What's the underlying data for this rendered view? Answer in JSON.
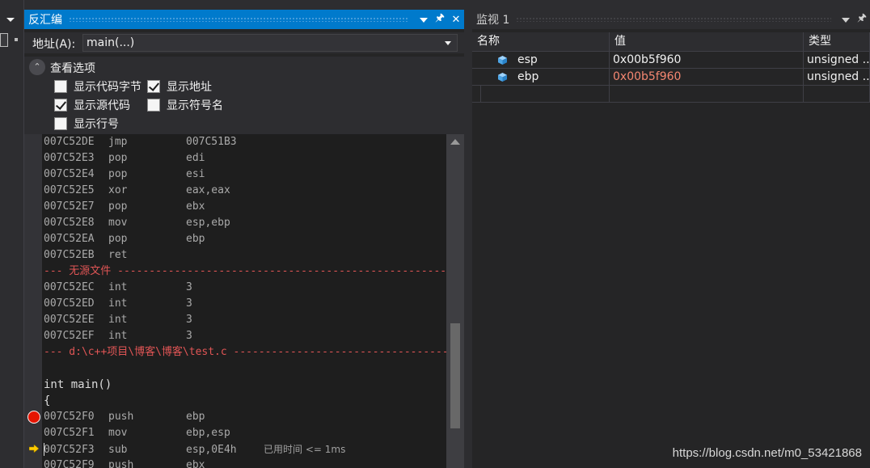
{
  "colors": {
    "accent": "#007acc",
    "separator_red": "#e05555",
    "changed_value": "#f48771",
    "breakpoint": "#e51400",
    "ip_arrow": "#ffcc00"
  },
  "disasm": {
    "title": "反汇编",
    "address_label": "地址(A):",
    "address_value": "main(...)",
    "options_title": "查看选项",
    "options": {
      "show_code_bytes": "显示代码字节",
      "show_address": "显示地址",
      "show_source": "显示源代码",
      "show_symbols": "显示符号名",
      "show_line_numbers": "显示行号"
    },
    "lines": [
      {
        "addr": "007C52DE",
        "mnemonic": "jmp",
        "operand": "007C51B3"
      },
      {
        "addr": "007C52E3",
        "mnemonic": "pop",
        "operand": "edi"
      },
      {
        "addr": "007C52E4",
        "mnemonic": "pop",
        "operand": "esi"
      },
      {
        "addr": "007C52E5",
        "mnemonic": "xor",
        "operand": "eax,eax"
      },
      {
        "addr": "007C52E7",
        "mnemonic": "pop",
        "operand": "ebx"
      },
      {
        "addr": "007C52E8",
        "mnemonic": "mov",
        "operand": "esp,ebp"
      },
      {
        "addr": "007C52EA",
        "mnemonic": "pop",
        "operand": "ebp"
      },
      {
        "addr": "007C52EB",
        "mnemonic": "ret",
        "operand": ""
      },
      {
        "sep": "--- 无源文件 ------------------------------------------------------------------------"
      },
      {
        "addr": "007C52EC",
        "mnemonic": "int",
        "operand": "3"
      },
      {
        "addr": "007C52ED",
        "mnemonic": "int",
        "operand": "3"
      },
      {
        "addr": "007C52EE",
        "mnemonic": "int",
        "operand": "3"
      },
      {
        "addr": "007C52EF",
        "mnemonic": "int",
        "operand": "3"
      },
      {
        "sep": "--- d:\\c++项目\\博客\\博客\\test.c --------------------------------------------------------"
      },
      {
        "src": ""
      },
      {
        "src": "int main()"
      },
      {
        "src": "{"
      },
      {
        "addr": "007C52F0",
        "mnemonic": "push",
        "operand": "ebp"
      },
      {
        "addr": "007C52F1",
        "mnemonic": "mov",
        "operand": "ebp,esp"
      },
      {
        "addr": "007C52F3",
        "mnemonic": "sub",
        "operand": "esp,0E4h",
        "note": "已用时间 <= 1ms"
      },
      {
        "addr": "007C52F9",
        "mnemonic": "push",
        "operand": "ebx"
      }
    ]
  },
  "watch": {
    "title": "监视 1",
    "columns": [
      "名称",
      "值",
      "类型"
    ],
    "rows": [
      {
        "name": "esp",
        "value": "0x00b5f960",
        "type": "unsigned ...",
        "changed": false
      },
      {
        "name": "ebp",
        "value": "0x00b5f960",
        "type": "unsigned ...",
        "changed": true
      }
    ]
  },
  "watermark": "https://blog.csdn.net/m0_53421868"
}
